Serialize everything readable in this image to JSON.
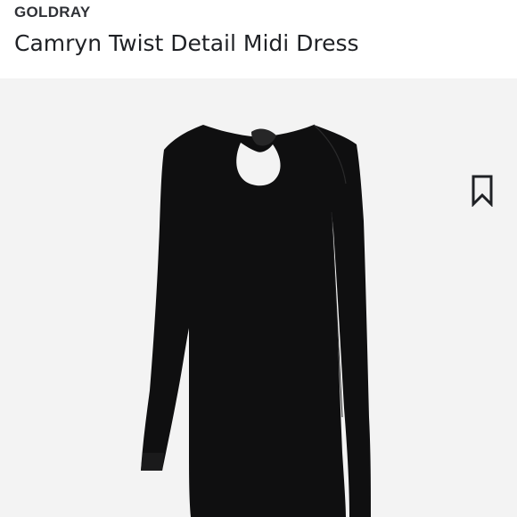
{
  "product": {
    "brand": "GOLDRAY",
    "title": "Camryn Twist Detail Midi Dress"
  },
  "colors": {
    "background": "#ffffff",
    "image_background": "#f3f3f3",
    "dress": "#0f0f10",
    "text_primary": "#1f2125",
    "text_brand": "#2f3136"
  },
  "icons": {
    "bookmark": "bookmark-icon"
  }
}
